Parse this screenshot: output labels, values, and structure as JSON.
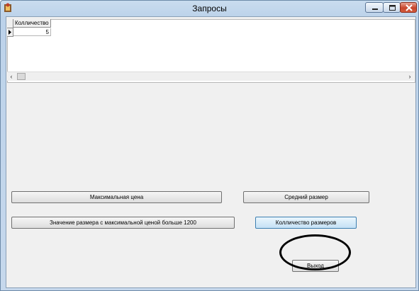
{
  "window": {
    "title": "Запросы"
  },
  "grid": {
    "column_header": "Колличество",
    "rows": [
      {
        "value": "5"
      }
    ]
  },
  "buttons": {
    "max_price": "Максимальная цена",
    "avg_size": "Средний размер",
    "size_max_price_over_1200": "Значение размера с максимальной ценой больше 1200",
    "size_count": "Колличество размеров",
    "exit": "Выход"
  }
}
